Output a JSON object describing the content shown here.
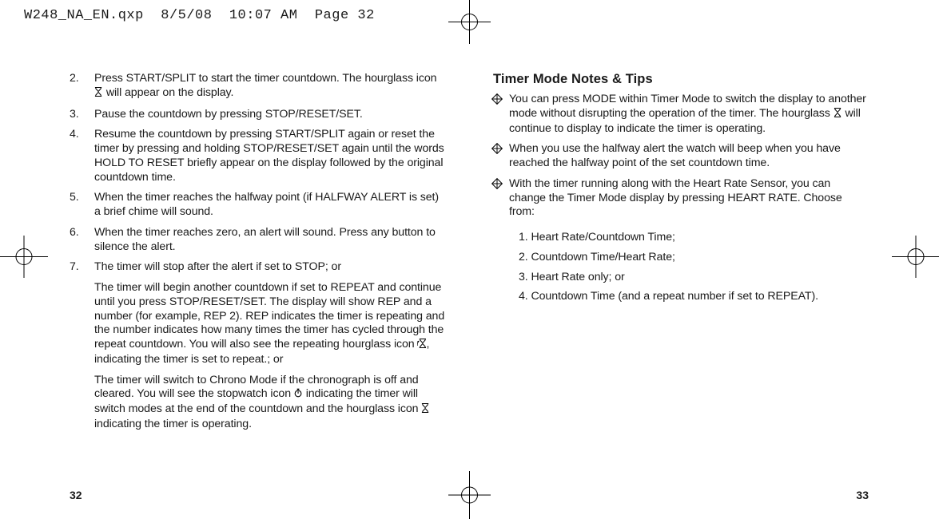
{
  "slug": "W248_NA_EN.qxp  8/5/08  10:07 AM  Page 32",
  "left": {
    "steps": [
      {
        "n": "2.",
        "parts": [
          {
            "text": "Press START/SPLIT to start the timer countdown. The hourglass icon "
          },
          {
            "icon": "hourglass"
          },
          {
            "text": " will appear on the display."
          }
        ]
      },
      {
        "n": "3.",
        "parts": [
          {
            "text": "Pause the countdown by pressing STOP/RESET/SET."
          }
        ]
      },
      {
        "n": "4.",
        "parts": [
          {
            "text": "Resume the countdown by pressing START/SPLIT again or reset the timer by pressing and holding STOP/RESET/SET again until the words HOLD TO RESET briefly appear on the display followed by the original countdown time."
          }
        ]
      },
      {
        "n": "5.",
        "parts": [
          {
            "text": "When the timer reaches the halfway point (if HALFWAY ALERT is set) a brief chime will sound."
          }
        ]
      },
      {
        "n": "6.",
        "parts": [
          {
            "text": "When the timer reaches zero, an alert will sound. Press any button to silence the alert."
          }
        ]
      },
      {
        "n": "7.",
        "parts": [
          {
            "text": "The timer will stop after the alert if set to STOP; or"
          }
        ],
        "subs": [
          [
            {
              "text": "The timer will begin another countdown if set to REPEAT and continue until you press STOP/RESET/SET. The display will show REP and a number (for example, REP 2). REP indicates the timer is repeating and the number indicates how many times the timer has cycled through the repeat countdown. You will also see the repeating hourglass icon "
            },
            {
              "icon": "hourglass-repeat"
            },
            {
              "text": ", indicating the timer is set to repeat.; or"
            }
          ],
          [
            {
              "text": "The timer will switch to Chrono Mode if the chronograph is off and cleared. You will see the stopwatch icon "
            },
            {
              "icon": "stopwatch"
            },
            {
              "text": " indicating the timer will switch modes at the end of the countdown and the hourglass icon "
            },
            {
              "icon": "hourglass"
            },
            {
              "text": " indicating the timer is operating."
            }
          ]
        ]
      }
    ]
  },
  "right": {
    "heading": "Timer Mode Notes & Tips",
    "tips": [
      [
        {
          "text": "You can press MODE within Timer Mode to switch the display to another mode without disrupting the operation of the timer. The hourglass "
        },
        {
          "icon": "hourglass"
        },
        {
          "text": " will continue to display to indicate the timer is operating."
        }
      ],
      [
        {
          "text": "When you use the halfway alert the watch will beep when you have reached the halfway point of the set countdown time."
        }
      ],
      [
        {
          "text": "With the timer running along with the Heart Rate Sensor, you can change the Timer Mode display by pressing HEART RATE. Choose from:"
        }
      ]
    ],
    "choices": [
      "1. Heart Rate/Countdown Time;",
      "2. Countdown Time/Heart Rate;",
      "3. Heart Rate only; or",
      "4. Countdown Time (and a repeat number if set to REPEAT)."
    ]
  },
  "page_left": "32",
  "page_right": "33"
}
